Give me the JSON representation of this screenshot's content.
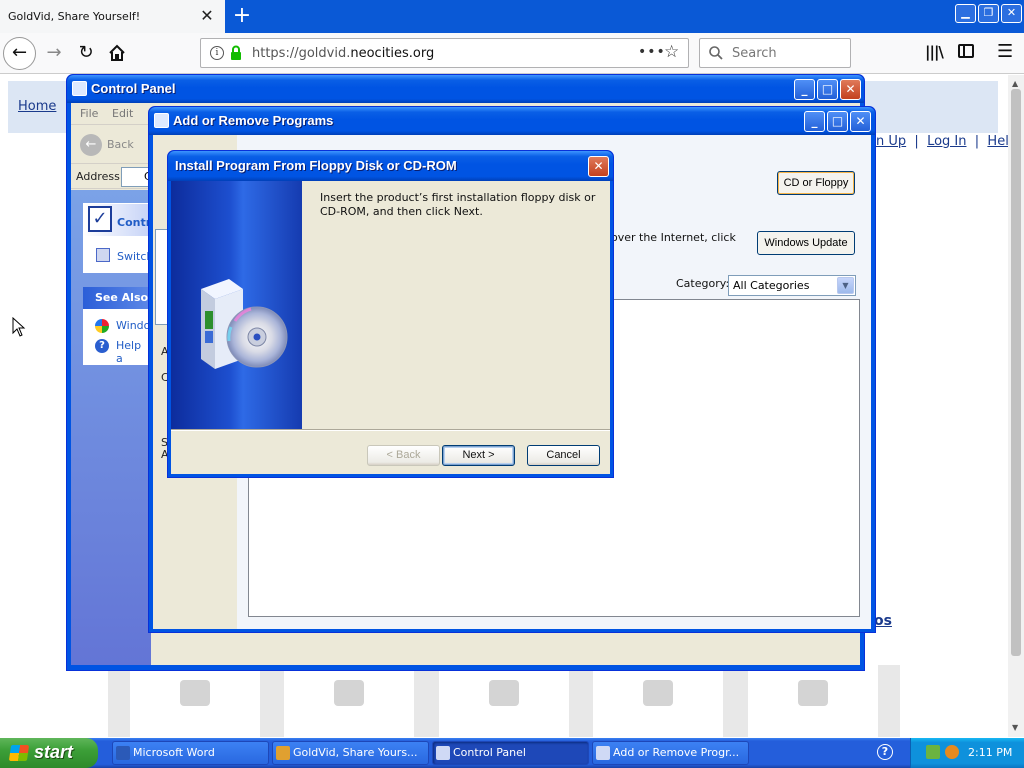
{
  "browser": {
    "tab_title": "GoldVid, Share Yourself!",
    "tab_close": "✕",
    "new_tab": "+",
    "url_prefix": "https://goldvid.",
    "url_domain": "neocities.org",
    "url_dots": "•••",
    "search_placeholder": "Search",
    "window_min": "▁",
    "window_restore": "❐",
    "window_close": "✕"
  },
  "webpage": {
    "home_link": "Home",
    "separator": "|",
    "sign_up_link": "n Up",
    "log_in_link": "Log In",
    "help_link": "Help",
    "bottom_link": "os"
  },
  "control_panel": {
    "title": "Control Panel",
    "menu": [
      "File",
      "Edit"
    ],
    "back_label": "Back",
    "address_label": "Address",
    "address_value": "C",
    "task_box1_title": "Contr",
    "task_box1_link": "Switch",
    "task_box2_title": "See Also",
    "task_box2_link1": "Windo",
    "task_box2_link2": "Help a"
  },
  "add_remove": {
    "title": "Add or Remove Programs",
    "cd_button": "CD or Floppy",
    "internet_text": "over the Internet, click",
    "windows_update_button": "Windows Update",
    "category_label": "Category:",
    "category_value": "All Categories",
    "left_labels": [
      "A",
      "C",
      "S",
      "A"
    ]
  },
  "dialog": {
    "title": "Install Program From Floppy Disk or CD-ROM",
    "message": "Insert the product’s first installation floppy disk or CD-ROM, and then click Next.",
    "back_button": "< Back",
    "next_button": "Next >",
    "cancel_button": "Cancel",
    "close_glyph": "✕"
  },
  "taskbar": {
    "start_label": "start",
    "tasks": [
      {
        "label": "Microsoft Word",
        "icon_color": "#2b5ab8"
      },
      {
        "label": "GoldVid, Share Yours...",
        "icon_color": "#e0a030"
      },
      {
        "label": "Control Panel",
        "icon_color": "#cfd9f5"
      },
      {
        "label": "Add or Remove Progr...",
        "icon_color": "#cfd9f5"
      }
    ],
    "clock": "2:11 PM"
  },
  "icons": {
    "back": "back-arrow-icon",
    "forward": "forward-arrow-icon",
    "reload": "reload-icon",
    "home": "home-icon",
    "bookmark": "bookmark-star-icon",
    "library": "library-icon",
    "sidebar": "sidebar-icon",
    "menu": "hamburger-menu-icon"
  },
  "colors": {
    "xp_title_blue": "#0054e3",
    "firefox_tabbar": "#0a59d6",
    "link_blue": "#1a3a8c",
    "start_green": "#3c9f38"
  }
}
